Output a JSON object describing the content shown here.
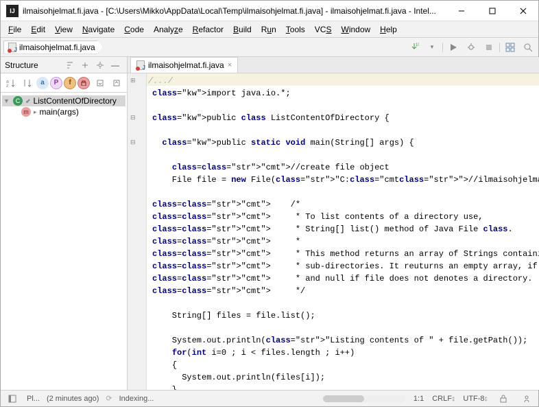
{
  "window": {
    "title": "ilmaisohjelmat.fi.java - [C:\\Users\\Mikko\\AppData\\Local\\Temp\\ilmaisohjelmat.fi.java] - ilmaisohjelmat.fi.java - Intel..."
  },
  "menu": [
    "File",
    "Edit",
    "View",
    "Navigate",
    "Code",
    "Analyze",
    "Refactor",
    "Build",
    "Run",
    "Tools",
    "VCS",
    "Window",
    "Help"
  ],
  "breadcrumb": {
    "file": "ilmaisohjelmat.fi.java"
  },
  "structure": {
    "title": "Structure",
    "class": "ListContentOfDirectory",
    "method": "main(args)"
  },
  "tab": {
    "file": "ilmaisohjelmat.fi.java"
  },
  "editor": {
    "fold_hint": "/.../",
    "lines": [
      "",
      "import java.io.*;",
      "",
      "public class ListContentOfDirectory {",
      "",
      "  public static void main(String[] args) {",
      "",
      "    //create file object",
      "    File file = new File(\"C://ilmaisohjelmat.fi\");",
      "",
      "    /*",
      "     * To list contents of a directory use,",
      "     * String[] list() method of Java File class.",
      "     *",
      "     * This method returns an array of Strings containing name of files and",
      "     * sub-directories. It reuturns an empty array, if directory is empty,",
      "     * and null if file does not denotes a directory.",
      "     */",
      "",
      "    String[] files = file.list();",
      "",
      "    System.out.println(\"Listing contents of \" + file.getPath());",
      "    for(int i=0 ; i < files.length ; i++)",
      "    {",
      "      System.out.println(files[i]);",
      "    }"
    ]
  },
  "status": {
    "left1": "Pl...",
    "left2": "(2 minutes ago)",
    "indexing": "Indexing...",
    "pos": "1:1",
    "crlf": "CRLF",
    "encoding": "UTF-8"
  }
}
